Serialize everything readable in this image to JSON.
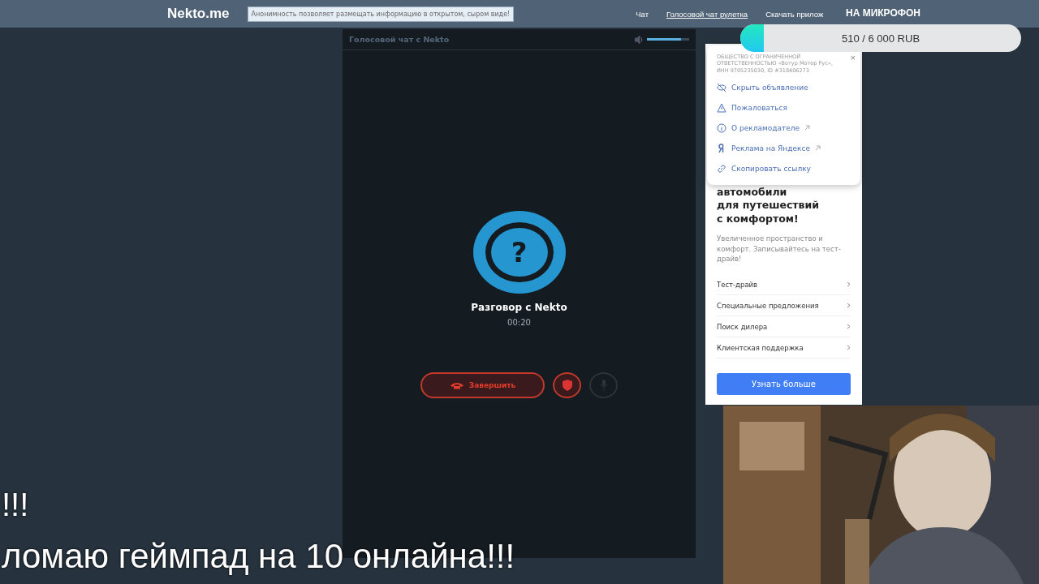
{
  "header": {
    "logo": "Nekto.me",
    "notice": "Анонимность позволяет размещать информацию в открытом, сыром виде!",
    "nav": [
      {
        "label": "Чат",
        "selected": false
      },
      {
        "label": "Голосовой чат рулетка",
        "selected": true
      },
      {
        "label": "Скачать прилож",
        "selected": false
      }
    ]
  },
  "call_panel": {
    "title": "Голосовой чат с Nekto",
    "volume": {
      "level": 0.8
    },
    "avatar": "?",
    "name": "Разговор с Nekto",
    "timer": "00:20",
    "buttons": [
      {
        "kind": "end",
        "label": "Завершить",
        "disabled": false
      },
      {
        "kind": "report",
        "disabled": false
      },
      {
        "kind": "mic",
        "disabled": true
      }
    ]
  },
  "ad": {
    "menu": {
      "advertiser": "ОБЩЕСТВО С ОГРАНИЧЕННОЙ ОТВЕТСТВЕННОСТЬЮ «Вотур Мотор Рус», ИНН 9705235030, ID #318406273",
      "close": "×",
      "items": [
        {
          "kind": "hide",
          "label": "Скрыть объявление",
          "external": false
        },
        {
          "kind": "report",
          "label": "Пожаловаться",
          "external": false
        },
        {
          "kind": "info",
          "label": "О рекламодателе",
          "external": true
        },
        {
          "kind": "yandex",
          "label": "Реклама на Яндексе",
          "external": true
        },
        {
          "kind": "link",
          "label": "Скопировать ссылку",
          "external": false
        }
      ]
    },
    "headline": "автомобили\nдля путешествий\nс комфортом!",
    "text": "Увеличенное пространство и комфорт. Записывайтесь на тест-драйв!",
    "links": [
      "Тест-драйв",
      "Специальные предложения",
      "Поиск дилера",
      "Клиентская поддержка"
    ],
    "cta": "Узнать больше"
  },
  "stream_overlay": {
    "goal_title": "НА МИКРОФОН",
    "goal": {
      "reading": "510 / 6 000 RUB",
      "level": 0.085
    },
    "webcam": {
      "kind": "picture"
    },
    "captions": [
      "!!!",
      "ломаю геймпад на 10 онлайна!!!"
    ]
  }
}
